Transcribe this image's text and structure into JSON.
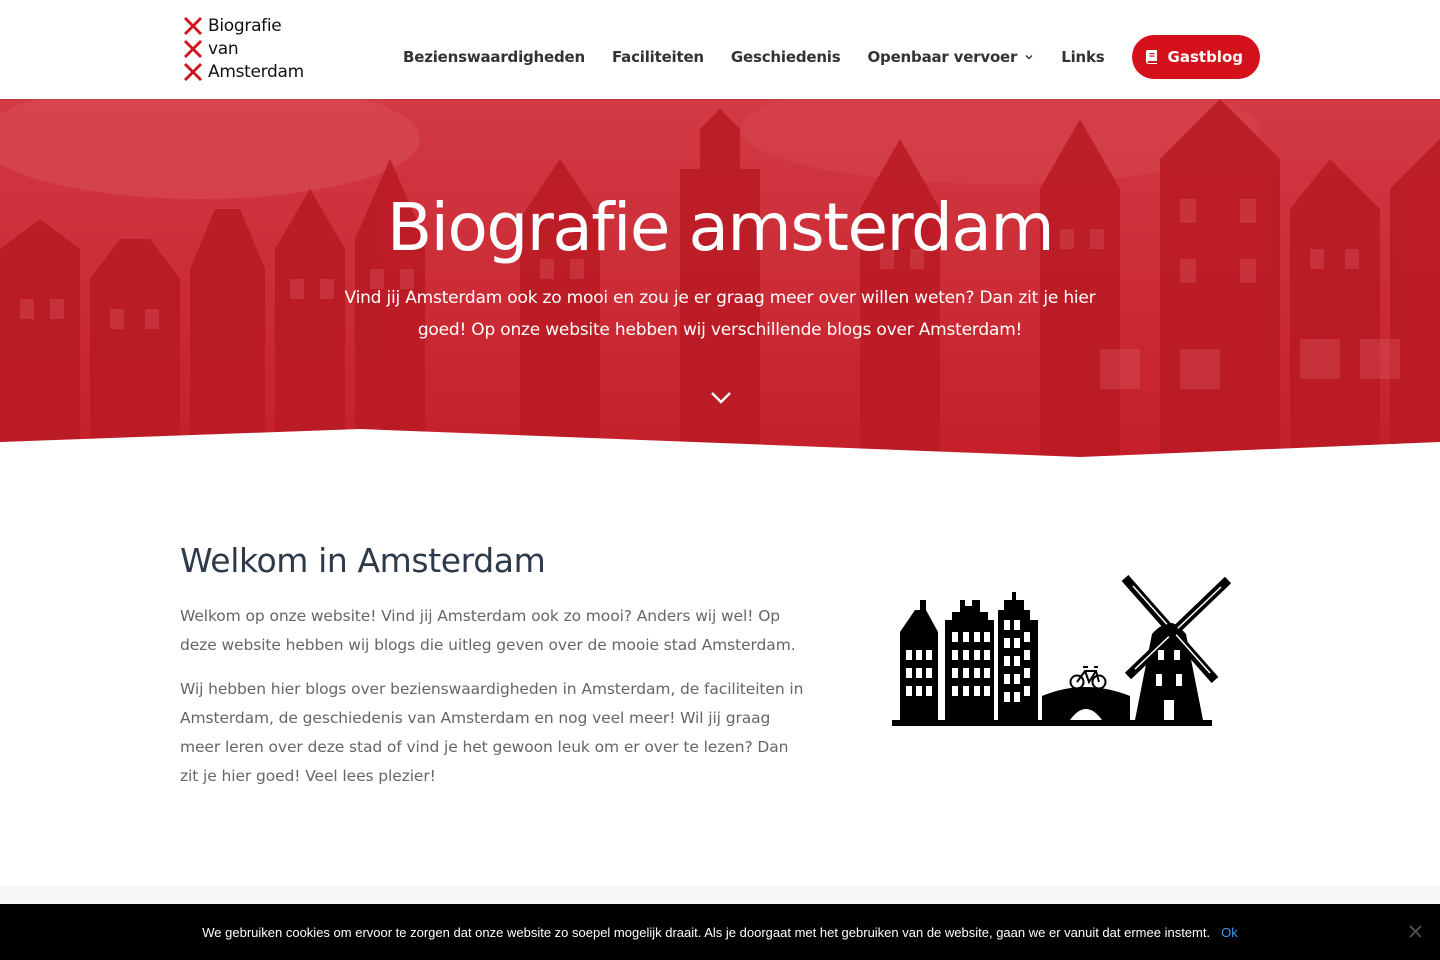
{
  "header": {
    "logo_lines": [
      "Biografie",
      "van",
      "Amsterdam"
    ],
    "nav": [
      {
        "label": "Bezienswaardigheden",
        "has_dropdown": false
      },
      {
        "label": "Faciliteiten",
        "has_dropdown": false
      },
      {
        "label": "Geschiedenis",
        "has_dropdown": false
      },
      {
        "label": "Openbaar vervoer",
        "has_dropdown": true
      },
      {
        "label": "Links",
        "has_dropdown": false
      }
    ],
    "cta_label": "Gastblog",
    "cta_icon": "book-icon"
  },
  "hero": {
    "title": "Biografie amsterdam",
    "subtitle": "Vind jij Amsterdam ook zo mooi en zou je er graag meer over willen weten? Dan zit je hier goed! Op onze website hebben wij verschillende blogs over Amsterdam!",
    "scroll_icon": "chevron-down-icon"
  },
  "welcome": {
    "title": "Welkom in Amsterdam",
    "paragraphs": [
      "Welkom op onze website! Vind jij Amsterdam ook zo mooi? Anders wij wel! Op deze website hebben wij blogs die uitleg geven over de mooie stad Amsterdam.",
      "Wij hebben hier blogs over bezienswaardigheden in Amsterdam, de faciliteiten in Amsterdam, de geschiedenis van Amsterdam en nog veel meer! Wil jij graag meer leren over deze stad of vind je het gewoon leuk om er over te lezen? Dan zit je hier goed! Veel lees plezier!"
    ]
  },
  "cookie": {
    "text": "We gebruiken cookies om ervoor te zorgen dat onze website zo soepel mogelijk draait. Als je doorgaat met het gebruiken van de website, gaan we er vanuit dat ermee instemt.",
    "ok_label": "Ok",
    "close_icon": "close-icon"
  },
  "colors": {
    "brand_red": "#d4111a",
    "hero_red": "#c8222b",
    "heading": "#2d3a49",
    "body_text": "#666666",
    "cookie_bg": "#000000",
    "cookie_link": "#3b9ded"
  }
}
